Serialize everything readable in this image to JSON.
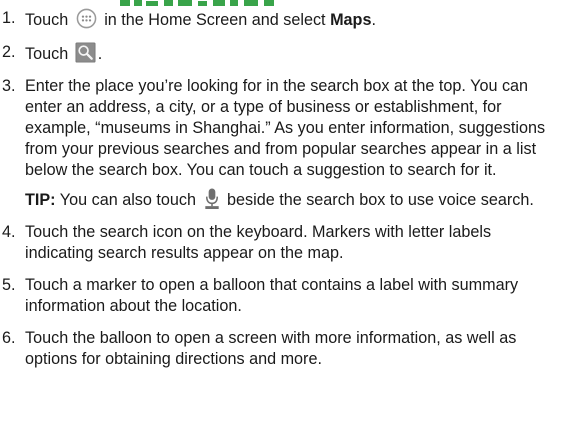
{
  "steps": [
    {
      "number": "1.",
      "pre": "Touch",
      "icon": "apps-icon",
      "mid": "in the Home Screen and select",
      "bold": "Maps",
      "end": "."
    },
    {
      "number": "2.",
      "pre": "Touch",
      "icon": "search-icon",
      "end": "."
    },
    {
      "number": "3.",
      "text": "Enter the place you’re looking for in the search box at the top. You can enter an address, a city, or a type of business or establishment, for example, “museums in Shanghai.” As you enter information, suggestions from your previous searches and from popular searches appear in a list below the search box. You can touch a suggestion to search for it.",
      "tip": {
        "label": "TIP:",
        "pre": "You can also touch",
        "icon": "microphone-icon",
        "post": "beside the search box to use voice search."
      }
    },
    {
      "number": "4.",
      "text": "Touch the search icon on the keyboard. Markers with letter labels indicating search results appear on the map."
    },
    {
      "number": "5.",
      "text": "Touch a marker to open a balloon that contains a label with summary information about the location."
    },
    {
      "number": "6.",
      "text": "Touch the balloon to open a screen with more information, as well as options for obtaining directions and more."
    }
  ],
  "colors": {
    "heading_green": "#39a44a",
    "text": "#1a1a1a",
    "icon_gray": "#9a9a9a"
  }
}
